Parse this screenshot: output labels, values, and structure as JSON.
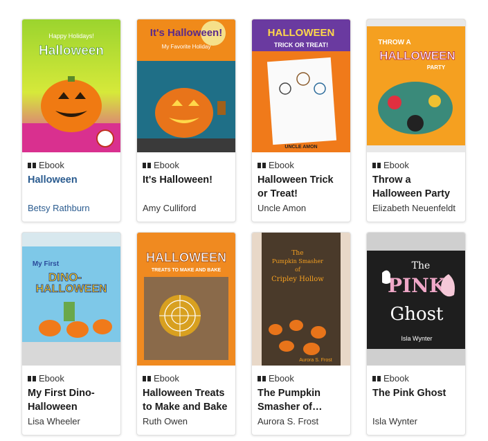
{
  "books": [
    {
      "format": "Ebook",
      "title": "Halloween",
      "author": "Betsy Rathburn",
      "cover_text": [
        "Happy Holidays!",
        "Halloween"
      ]
    },
    {
      "format": "Ebook",
      "title": "It's Halloween!",
      "author": "Amy Culliford",
      "cover_text": [
        "It's Halloween!",
        "My Favorite Holiday"
      ]
    },
    {
      "format": "Ebook",
      "title": "Halloween Trick or Treat!",
      "author": "Uncle Amon",
      "cover_text": [
        "HALLOWEEN",
        "TRICK OR TREAT!",
        "UNCLE AMON"
      ]
    },
    {
      "format": "Ebook",
      "title": "Throw a Halloween Party",
      "author": "Elizabeth Neuenfeldt",
      "cover_text": [
        "THROW A",
        "HALLOWEEN",
        "PARTY"
      ]
    },
    {
      "format": "Ebook",
      "title": "My First Dino-Halloween",
      "author": "Lisa Wheeler",
      "cover_text": [
        "My First",
        "DINO-",
        "HALLOWEEN"
      ]
    },
    {
      "format": "Ebook",
      "title": "Halloween Treats to Make and Bake",
      "author": "Ruth Owen",
      "cover_text": [
        "HALLOWEEN",
        "TREATS TO MAKE AND BAKE"
      ]
    },
    {
      "format": "Ebook",
      "title": "The Pumpkin Smasher of…",
      "author": "Aurora S. Frost",
      "cover_text": [
        "The",
        "Pumpkin Smasher",
        "of",
        "Cripley Hollow",
        "Aurora S. Frost"
      ]
    },
    {
      "format": "Ebook",
      "title": "The Pink Ghost",
      "author": "Isla Wynter",
      "cover_text": [
        "The",
        "PINK",
        "Ghost",
        "Isla Wynter"
      ]
    }
  ],
  "colors": {
    "link": "#2a5b8f",
    "text": "#1a1a1a"
  }
}
